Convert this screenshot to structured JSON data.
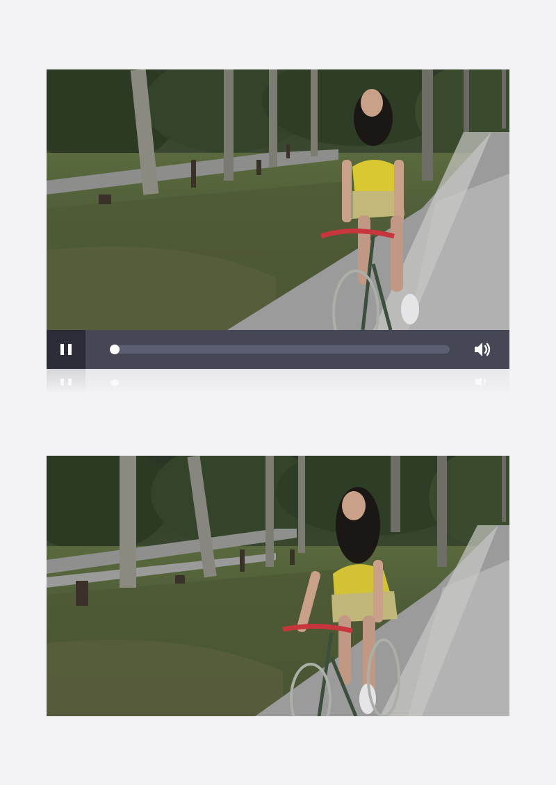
{
  "player": {
    "pause_label": "Pause",
    "volume_label": "Volume",
    "progress": 0.0
  },
  "frames": {
    "top_description": "",
    "bottom_description": ""
  },
  "icons": {
    "pause": "pause-icon",
    "volume": "volume-icon"
  },
  "colors": {
    "control_bar": "#454756",
    "play_button_bg": "#2b2c37",
    "track": "#5c5e72",
    "page_background": "#f3f3f5"
  }
}
